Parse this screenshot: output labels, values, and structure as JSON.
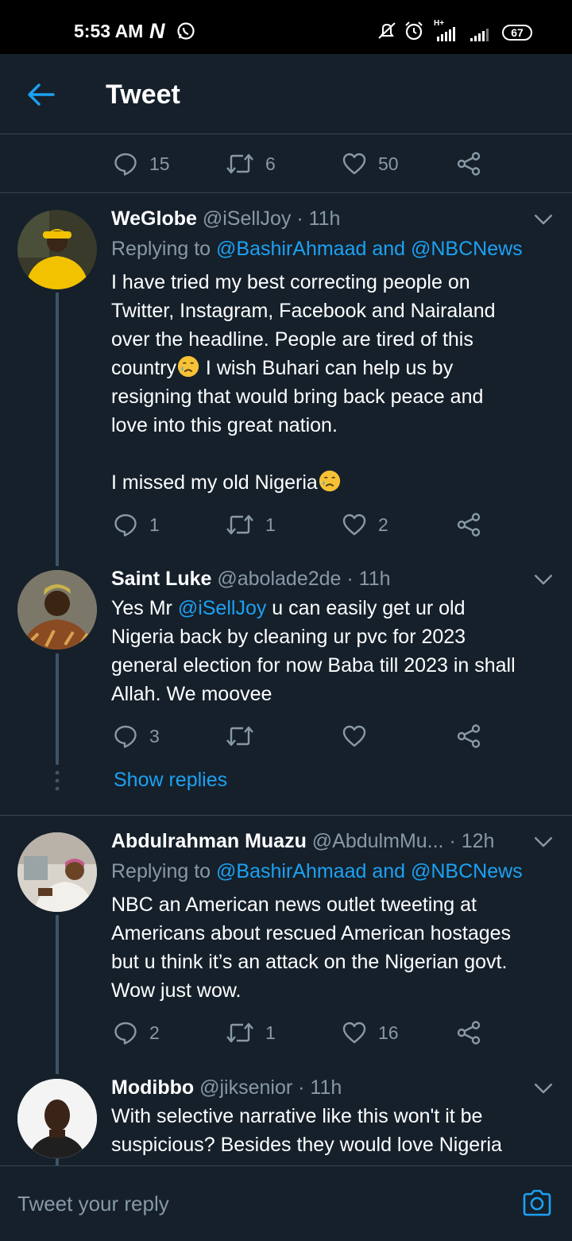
{
  "status_bar": {
    "time": "5:53 AM",
    "netflix_icon": "N",
    "network_label": "H+",
    "battery": "67"
  },
  "header": {
    "title": "Tweet"
  },
  "main_tweet_actions": {
    "replies": "15",
    "retweets": "6",
    "likes": "50"
  },
  "tweets": [
    {
      "name": "WeGlobe",
      "handle": "@iSellJoy",
      "time": "· 11h",
      "replying_prefix": "Replying to ",
      "replying_to": "@BashirAhmaad and @NBCNews",
      "text_line_1": "I have tried my best correcting people on",
      "text_line_2": "Twitter, Instagram, Facebook and Nairaland",
      "text_line_3": "over the headline. People are tired of this",
      "text_line_4_a": "country",
      "text_line_4_b": " I wish Buhari can help us by",
      "text_line_5": "resigning that would bring back peace and",
      "text_line_6": "love into this great nation.",
      "text_line_7": "I missed my old Nigeria",
      "replies": "1",
      "retweets": "1",
      "likes": "2"
    },
    {
      "name": "Saint Luke",
      "handle": "@abolade2de",
      "time": "· 11h",
      "text_prefix": "Yes Mr ",
      "mention": "@iSellJoy",
      "text_line_1_rest": " u can easily get ur old",
      "text_line_2": "Nigeria back by cleaning ur pvc for 2023",
      "text_line_3": "general election for now Baba till 2023 in shall",
      "text_line_4": "Allah. We moovee",
      "replies": "3",
      "retweets": "",
      "likes": ""
    },
    {
      "name": "Abdulrahman Muazu",
      "handle": "@AbdulmMu...",
      "time": "· 12h",
      "replying_prefix": "Replying to ",
      "replying_to": "@BashirAhmaad and @NBCNews",
      "text_line_1": "NBC an American news outlet tweeting at",
      "text_line_2": "Americans about rescued American hostages",
      "text_line_3": "but u think it’s an attack on the Nigerian govt.",
      "text_line_4": "Wow just wow.",
      "replies": "2",
      "retweets": "1",
      "likes": "16"
    },
    {
      "name": "Modibbo",
      "handle": "@jiksenior",
      "time": "· 11h",
      "text_line_1": "With selective narrative like this won't it be",
      "text_line_2": "suspicious? Besides they would love Nigeria"
    }
  ],
  "show_replies": "Show replies",
  "reply_bar": {
    "placeholder": "Tweet your reply"
  },
  "icons": {
    "back": "arrow-left-icon",
    "reply": "speech-bubble-icon",
    "retweet": "retweet-icon",
    "like": "heart-icon",
    "share": "share-icon",
    "more": "chevron-down-icon",
    "camera": "camera-icon"
  },
  "colors": {
    "background": "#15202b",
    "accent": "#1da1f2",
    "secondary_text": "#8899a6",
    "divider": "#38444d"
  }
}
